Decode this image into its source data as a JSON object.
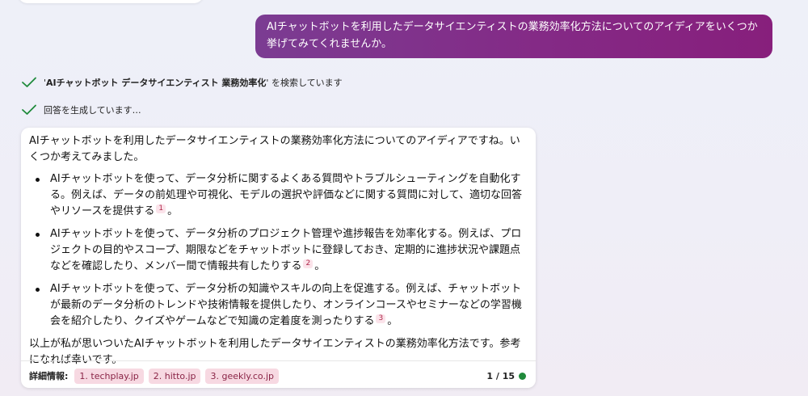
{
  "user_message": "AIチャットボットを利用したデータサイエンティストの業務効率化方法についてのアイディアをいくつか挙げてみてくれませんか。",
  "status": {
    "search_quote_open": "'",
    "search_query": "AIチャットボット データサイエンティスト 業務効率化",
    "search_suffix": "' を検索しています",
    "generating": "回答を生成しています…"
  },
  "answer": {
    "intro": "AIチャットボットを利用したデータサイエンティストの業務効率化方法についてのアイディアですね。いくつか考えてみました。",
    "bullets": [
      {
        "text": "AIチャットボットを使って、データ分析に関するよくある質問やトラブルシューティングを自動化する。例えば、データの前処理や可視化、モデルの選択や評価などに関する質問に対して、適切な回答やリソースを提供する",
        "cite": "1",
        "end": "。"
      },
      {
        "text": "AIチャットボットを使って、データ分析のプロジェクト管理や進捗報告を効率化する。例えば、プロジェクトの目的やスコープ、期限などをチャットボットに登録しておき、定期的に進捗状況や課題点などを確認したり、メンバー間で情報共有したりする",
        "cite": "2",
        "end": "。"
      },
      {
        "text": "AIチャットボットを使って、データ分析の知識やスキルの向上を促進する。例えば、チャットボットが最新のデータ分析のトレンドや技術情報を提供したり、オンラインコースやセミナーなどの学習機会を紹介したり、クイズやゲームなどで知識の定着度を測ったりする",
        "cite": "3",
        "end": "。"
      }
    ],
    "outro": "以上が私が思いついたAIチャットボットを利用したデータサイエンティストの業務効率化方法です。参考になれば幸いです。"
  },
  "footer": {
    "more_label": "詳細情報:",
    "sources": [
      "1. techplay.jp",
      "2. hitto.jp",
      "3. geekly.co.jp"
    ],
    "page_count": "1 / 15"
  },
  "colors": {
    "user_bubble": "#842a86",
    "check": "#1f8a3b",
    "cite_bg": "#fbe3ea",
    "status_dot": "#1f8a3b"
  }
}
